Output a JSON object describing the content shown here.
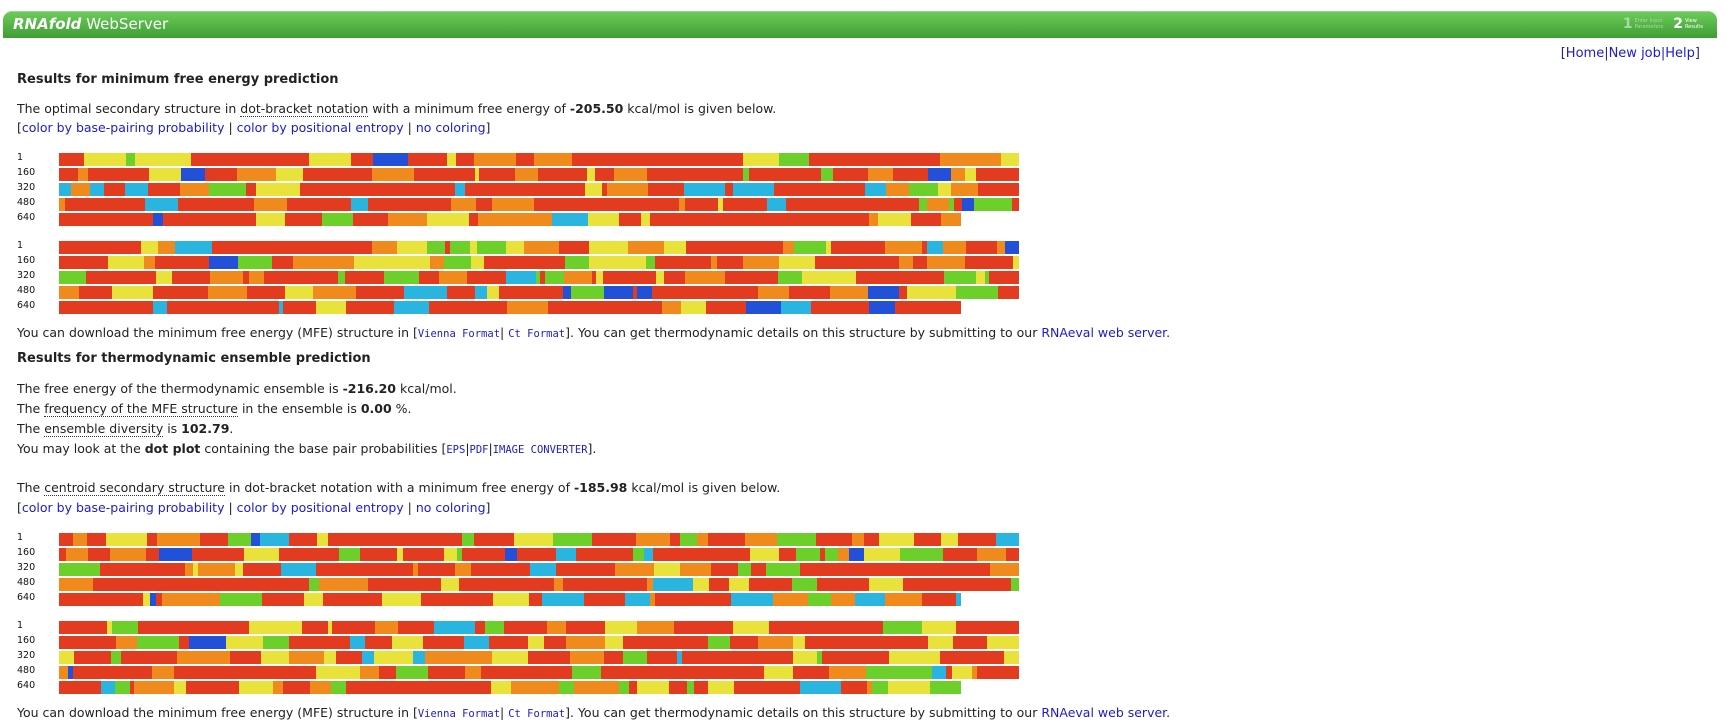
{
  "header": {
    "brand_italic": "RNAfold",
    "brand_rest": "WebServer",
    "steps": [
      {
        "num": "1",
        "label_1": "Enter Input",
        "label_2": "Parameters"
      },
      {
        "num": "2",
        "label_1": "View",
        "label_2": "Results"
      }
    ]
  },
  "nav": {
    "home": "Home",
    "new_job": "New job",
    "help": "Help"
  },
  "mfe": {
    "title": "Results for minimum free energy prediction",
    "intro_1": "The optimal secondary structure in ",
    "intro_link": "dot-bracket notation",
    "intro_2": " with a minimum free energy of ",
    "energy": "-205.50",
    "intro_3": " kcal/mol is given below.",
    "color_bp": "color by base-pairing probability",
    "color_entropy": "color by positional entropy",
    "no_coloring": "no coloring",
    "download_1": "You can download the minimum free energy (MFE) structure in [",
    "vienna": "Vienna Format",
    "ct": "Ct Format",
    "download_2": "]. You can get thermodynamic details on this structure by submitting to our ",
    "rnaeval": "RNAeval web server",
    "download_3": "."
  },
  "ensemble": {
    "title": "Results for thermodynamic ensemble prediction",
    "fe_1": "The free energy of the thermodynamic ensemble is ",
    "fe_val": "-216.20",
    "fe_2": " kcal/mol.",
    "freq_1": "The ",
    "freq_link": "frequency of the MFE structure",
    "freq_2": " in the ensemble is ",
    "freq_val": "0.00",
    "freq_3": " %.",
    "div_1": "The ",
    "div_link": "ensemble diversity",
    "div_2": " is ",
    "div_val": "102.79",
    "div_3": ".",
    "dot_1": "You may look at the ",
    "dot_bold": "dot plot",
    "dot_2": " containing the base pair probabilities [",
    "eps": "EPS",
    "pdf": "PDF",
    "img": "IMAGE CONVERTER",
    "dot_3": "].",
    "cent_1": "The ",
    "cent_link": "centroid secondary structure",
    "cent_2": " in dot-bracket notation with a minimum free energy of ",
    "cent_val": "-185.98",
    "cent_3": " kcal/mol is given below."
  },
  "line_numbers": [
    "1",
    "160",
    "320",
    "480",
    "640"
  ],
  "colors": {
    "red": "#e23b1f",
    "orange": "#f08a1c",
    "yellow": "#e8e23a",
    "green": "#6ccf2a",
    "cyan": "#2ab5e0",
    "blue": "#2350d8"
  }
}
